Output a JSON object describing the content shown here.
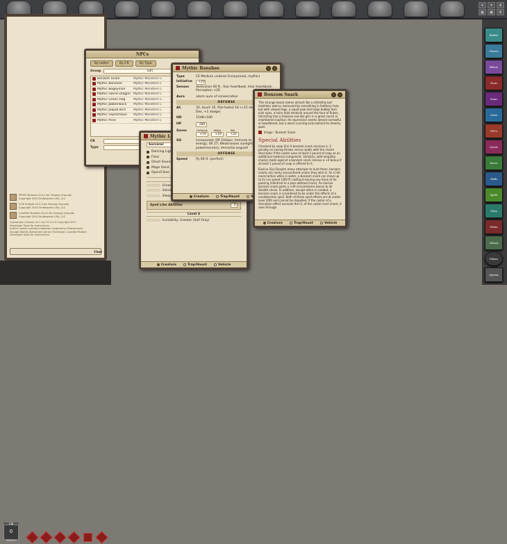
{
  "chat": {
    "lines": [
      "PFRPG Ruleset v3.3.3 for Fantasy Grounds",
      "Copyright 2015 Smiteworks USA, LLC",
      "3.5E Ruleset v3.3.3 for Fantasy Grounds",
      "Copyright 2015 Smiteworks USA, LLC",
      "CoreRPG Ruleset v3.3.3 for Fantasy Grounds",
      "Copyright 2015 Smiteworks USA, LLC",
      "Conversion Checker v0.1 for FG 3.3.3 Copyright 2017",
      "Developer Tools for Instructions",
      "Author: James Lockhart-Holbrook (inspired by Ekstremoris)",
      "Savage Worlds (Advanced Library Extension): Loaded Module",
      "Developer Tools for Instructions"
    ],
    "chat_label": "Chat"
  },
  "dicebar": {
    "gm_label": "GM",
    "modifier": "0",
    "modifier_label": "Modifier"
  },
  "sidebar": {
    "buttons": [
      {
        "label": "Battles",
        "color": "#3a8a8a"
      },
      {
        "label": "Classes",
        "color": "#3a7a9a"
      },
      {
        "label": "Effects",
        "color": "#7a4a9a"
      },
      {
        "label": "Feats",
        "color": "#8a2a2a"
      },
      {
        "label": "Items",
        "color": "#6a2a7a"
      },
      {
        "label": "Notes",
        "color": "#2a6a9a"
      },
      {
        "label": "NPCs",
        "color": "#9a3a2a"
      },
      {
        "label": "Quests",
        "color": "#8a2a5a"
      },
      {
        "label": "Races",
        "color": "#3a7a3a"
      },
      {
        "label": "Skills",
        "color": "#2a5a8a"
      },
      {
        "label": "Spells",
        "color": "#4a8a2a"
      },
      {
        "label": "Story",
        "color": "#2a7a6a"
      },
      {
        "label": "Tables",
        "color": "#7a2a2a"
      },
      {
        "label": "Library",
        "color": "#4a6a4a"
      },
      {
        "label": "Tokens",
        "color": "#3a3a3a"
      },
      {
        "label": "Options",
        "color": "#555555"
      }
    ]
  },
  "npcs": {
    "title": "NPCs",
    "tabs": [
      "By Letter",
      "By CR",
      "By Type"
    ],
    "group_label": "Group",
    "group_value": "(all)",
    "rows": [
      {
        "name": "Bonzom Snark",
        "source": "Mythic Monsters C"
      },
      {
        "name": "Mythic Banshee",
        "source": "Mythic Monsters C"
      },
      {
        "name": "Mythic Bogeyman",
        "source": "Mythic Monsters C"
      },
      {
        "name": "Mythic Faerie Dragon",
        "source": "Mythic Monsters C"
      },
      {
        "name": "Mythic Green Hag",
        "source": "Mythic Monsters C"
      },
      {
        "name": "Mythic Jabberwock",
        "source": "Mythic Monsters C"
      },
      {
        "name": "Mythic Jubjub Bird",
        "source": "Mythic Monsters C"
      },
      {
        "name": "Mythic Leprechaun",
        "source": "Mythic Monsters C"
      },
      {
        "name": "Mythic Pixie",
        "source": "Mythic Monsters C"
      }
    ],
    "filter_cr": "CR",
    "filter_type": "Type"
  },
  "banshee": {
    "title": "Mythic Banshee",
    "type_label": "Type",
    "type_value": "CE Medium undead (incorporeal, mythic)",
    "init_label": "Initiative",
    "init_value": "+20",
    "senses_label": "Senses",
    "senses_value": "darkvision 60 ft., fear heartbeat, hear heartbeat; Perception +26",
    "aura_label": "Aura",
    "aura_value": "alarm aura of consecration",
    "defense": "DEFENSE",
    "ac_label": "AC",
    "ac_value": "35, touch 35, flat-footed 18 (+15 deflection, +8 Dex, +1 dodge)",
    "hd_label": "HD",
    "hd_value": "15d8+180",
    "hp_label": "HP",
    "hp_value": "280",
    "saves_label": "Saves",
    "fort_label": "Fortitude",
    "fort": "+19",
    "ref_label": "Reflex",
    "ref": "+19",
    "will_label": "Will",
    "will": "+20",
    "sq_label": "SQ",
    "sq_value": "incorporeal; DR 10/epic; immune to channeled energy; SR 27; Weaknesses sunlight powerlessness, immortal anguish",
    "offense": "OFFENSE",
    "speed_label": "Speed",
    "speed_value": "fly 60 ft. (perfect)",
    "tabs": [
      "Creature",
      "Trap/Haunt",
      "Vehicle"
    ]
  },
  "bonzom": {
    "title": "Bonzom Snark",
    "desc": "This strange beast seems almost like a childishly but toothless walrus, bemused by everything in feathery fuzz, but with clawed legs, a squat paw and large bubbly lean pink eyes, a hairy dark tentacle around the face of flukes, retracting into a massive sea-like grin in a great conch or chambered nautilus. Its expression seems almost sorrowful or bewildered, but a warm cunning lurks behind its dreamy gaze.",
    "image_label": "Image - Bonzom Snark",
    "abilities_heading": "Special Abilities",
    "ability1": "Charmed by soap (Ex) A bonzom snark receives a -2 penalty on saving throws versus spells with the charm descriptor if the caster uses at least 1 pound of soap as an additional material component. Similarly, wild empathy checks made against a bonzom snark receive a +4 bonus if at least 1 pound of soap is offered to it.",
    "ability2": "Elusive (Su) Despite many attempts to hunt them, bonzom snarks are rarely encountered unless they wish it. As a full-round action while in water, a bonzom snark can move up to its run speed (300 ft.) without leaving any trace of its passing (identical to a pass without trace). An elusive bonzom snark gains a +40 circumstance bonus to its Stealth check. In addition, except when in combat, a bonzom snark is considered to be under the effects of a nondetection spell. Both of these spell effects are at caster level 20th and cannot be dispelled. If the caster of a divination effect exceeds the CL of the caster level check, it sees through.",
    "tabs": [
      "Creature",
      "Trap/Haunt",
      "Vehicle"
    ]
  },
  "spellwin": {
    "title": "Mythic Leprechaun",
    "caster_label": "Sorcerer",
    "spells": [
      "Dancing Lights",
      "Flare",
      "Ghost Sound",
      "Mage Hand",
      "Open/Close"
    ],
    "level1": "Level 1",
    "level1_spells": [
      "Grease",
      "Silent Image",
      "Sleep"
    ],
    "spell_like": "Spell Like Abilities",
    "spell_like_val": "3",
    "level4": "Level 4",
    "level4_spells": [
      "Invisibility, Greater (Self Only)"
    ],
    "tabs": [
      "Creature",
      "Trap/Haunt",
      "Vehicle"
    ]
  }
}
